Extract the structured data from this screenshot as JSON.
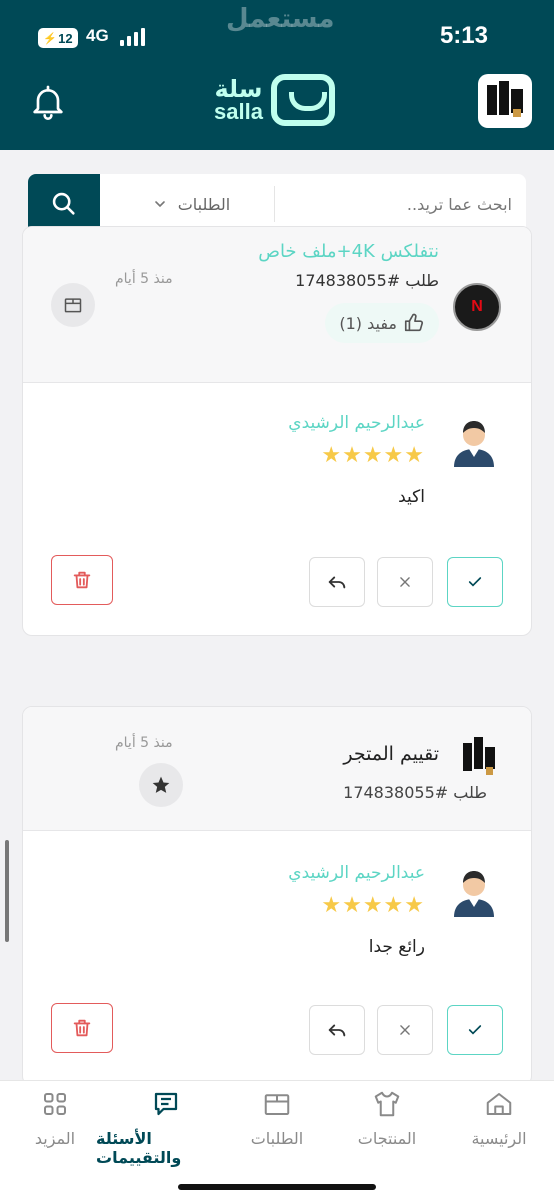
{
  "status_bar": {
    "time": "5:13",
    "network": "4G",
    "battery": "12"
  },
  "header": {
    "watermark": "مستعمل",
    "logo_ar": "سلة",
    "logo_en": "salla",
    "brand_color": "#004956",
    "accent_color": "#5cd5c4"
  },
  "search": {
    "placeholder": "ابحث عما تريد..",
    "filter_selected": "الطلبات"
  },
  "reviews": [
    {
      "product_title": "نتفلكس 4K+ملف خاص",
      "order_number": "طلب #174838055",
      "helpful_label": "مفيد (1)",
      "since": "منذ 5 أيام",
      "reviewer_name": "عبدالرحيم الرشيدي",
      "rating": 5,
      "stars": "★★★★★",
      "comment": "اكيد"
    },
    {
      "product_title": "تقييم المتجر",
      "order_number": "طلب #174838055",
      "since": "منذ 5 أيام",
      "reviewer_name": "عبدالرحيم الرشيدي",
      "rating": 5,
      "stars": "★★★★★",
      "comment": "رائع جدا"
    }
  ],
  "bottom_nav": [
    {
      "label": "الرئيسية",
      "icon": "home-icon"
    },
    {
      "label": "المنتجات",
      "icon": "shirt-icon"
    },
    {
      "label": "الطلبات",
      "icon": "box-icon"
    },
    {
      "label": "الأسئلة والتقييمات",
      "icon": "message-icon",
      "active": true
    },
    {
      "label": "المزيد",
      "icon": "grid-icon"
    }
  ]
}
